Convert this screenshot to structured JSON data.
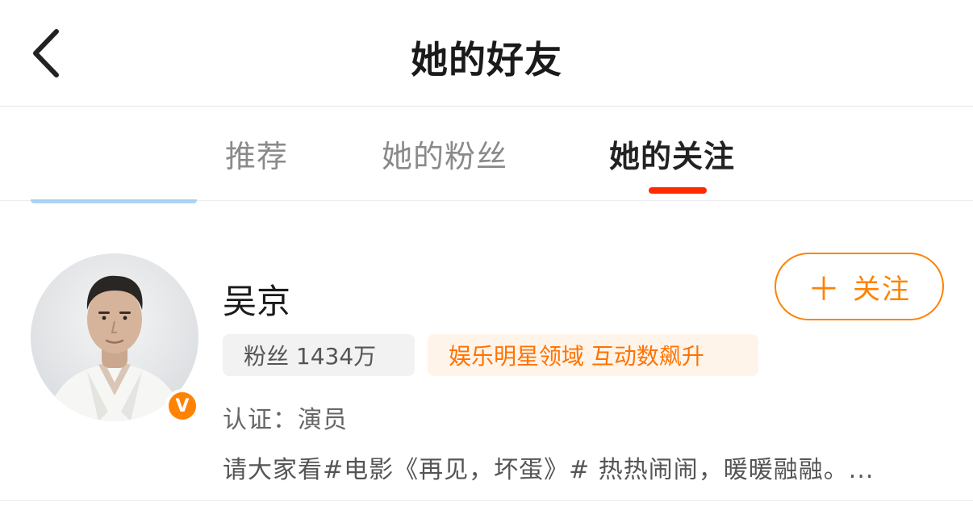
{
  "header": {
    "back_icon": "chevron-left-icon",
    "title": "她的好友"
  },
  "tabs": [
    {
      "label": "推荐",
      "active": false
    },
    {
      "label": "她的粉丝",
      "active": false
    },
    {
      "label": "她的关注",
      "active": true
    }
  ],
  "colors": {
    "accent_orange": "#ff8200",
    "tab_indicator": "#ff2a00",
    "tag_hot_bg": "#fff4ea",
    "tag_fans_bg": "#f2f2f2"
  },
  "user": {
    "name": "吴京",
    "verified_badge": "V",
    "follow_button": {
      "icon": "plus-icon",
      "plus": "＋",
      "label": "关注"
    },
    "fans_tag": "粉丝 1434万",
    "hot_tag": "娱乐明星领域 互动数飙升",
    "certification": "认证：演员",
    "latest_post": "请大家看#电影《再见，坏蛋》# 热热闹闹，暖暖融融。..."
  }
}
